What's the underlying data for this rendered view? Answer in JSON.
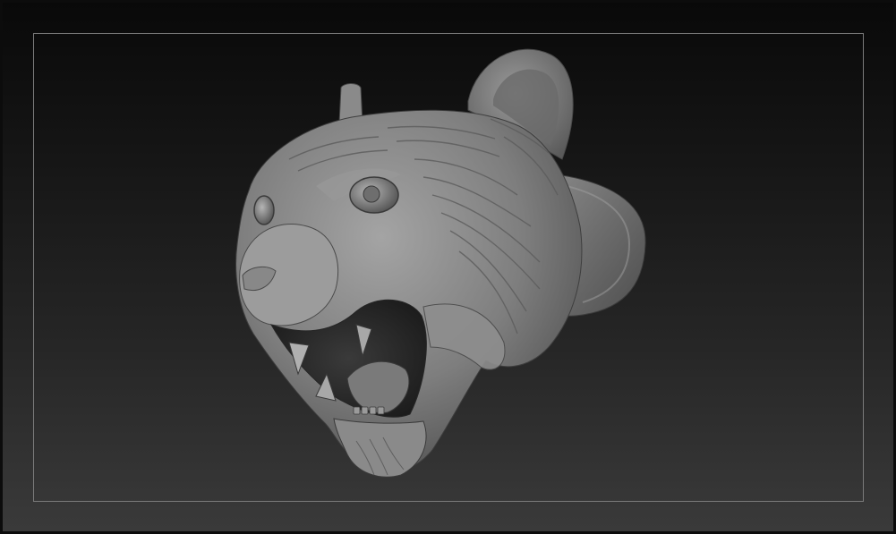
{
  "viewport": {
    "background_top": "#090909",
    "background_bottom": "#3a3a3a",
    "frame_color": "#7a7a7a"
  },
  "model": {
    "subject": "tiger-head-ring-sculpt",
    "material_color": "#8c8c8c"
  }
}
